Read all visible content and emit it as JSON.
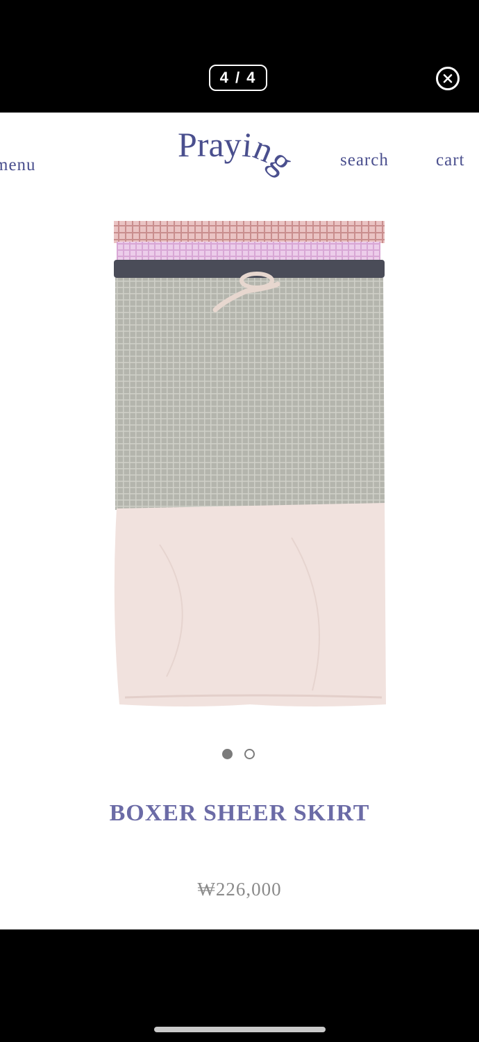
{
  "viewer": {
    "counter": "4 / 4",
    "close_icon": "close-circle-icon"
  },
  "header": {
    "menu_label": "menu",
    "logo_text": "Praying",
    "search_label": "search",
    "cart_label": "cart"
  },
  "product": {
    "image": "boxer-sheer-skirt-photo",
    "title": "BOXER SHEER SKIRT",
    "price": "₩226,000",
    "carousel": {
      "total": 2,
      "active_index": 0
    }
  },
  "colors": {
    "brand": "#4a4f8e",
    "title": "#6b6ba6",
    "price": "#8a8a8a"
  }
}
